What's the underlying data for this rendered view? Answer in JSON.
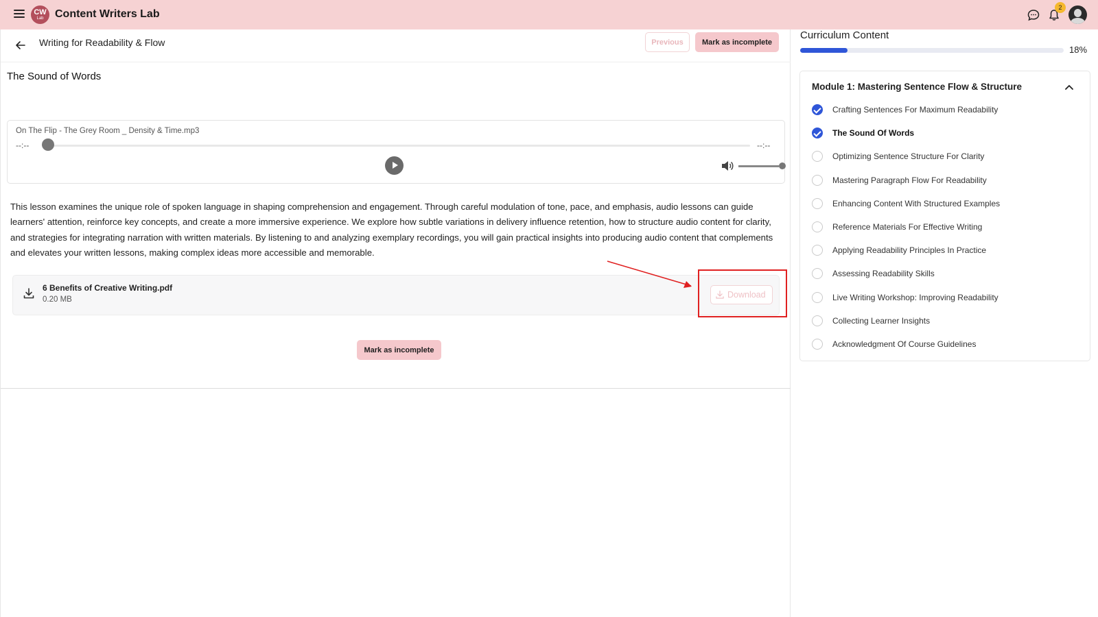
{
  "app": {
    "logo_text": "CW",
    "logo_sub": "Lab",
    "title": "Content Writers Lab",
    "notifications_count": "2"
  },
  "lesson": {
    "header_title": "Writing for Readability & Flow",
    "previous_label": "Previous",
    "mark_incomplete_label": "Mark as incomplete",
    "section_title": "The Sound of Words",
    "audio": {
      "file_name": "On The Flip - The Grey Room _ Density & Time.mp3",
      "current_time": "--:--",
      "duration": "--:--",
      "position_fraction": 0,
      "volume_fraction": 1.0
    },
    "description": "This lesson examines the unique role of spoken language in shaping comprehension and engagement. Through careful modulation of tone, pace, and emphasis, audio lessons can guide learners' attention, reinforce key concepts, and create a more immersive experience. We explore how subtle variations in delivery influence retention, how to structure audio content for clarity, and strategies for integrating narration with written materials. By listening to and analyzing exemplary recordings, you will gain practical insights into producing audio content that complements and elevates your written lessons, making complex ideas more accessible and memorable.",
    "attachment": {
      "file_name": "6 Benefits of Creative Writing.pdf",
      "file_size": "0.20 MB",
      "download_label": "Download"
    },
    "bottom_mark_label": "Mark as incomplete"
  },
  "curriculum": {
    "title": "Curriculum Content",
    "progress_percent": 18,
    "progress_text": "18%",
    "module": {
      "title": "Module 1: Mastering Sentence Flow & Structure",
      "lessons": [
        {
          "label": "Crafting Sentences For Maximum Readability",
          "done": true
        },
        {
          "label": "The Sound Of Words",
          "done": true,
          "active": true
        },
        {
          "label": "Optimizing Sentence Structure For Clarity",
          "done": false
        },
        {
          "label": "Mastering Paragraph Flow For Readability",
          "done": false
        },
        {
          "label": "Enhancing Content With Structured Examples",
          "done": false
        },
        {
          "label": "Reference Materials For Effective Writing",
          "done": false
        },
        {
          "label": "Applying Readability Principles In Practice",
          "done": false
        },
        {
          "label": "Assessing Readability Skills",
          "done": false
        },
        {
          "label": "Live Writing Workshop: Improving Readability",
          "done": false
        },
        {
          "label": "Collecting Learner Insights",
          "done": false
        },
        {
          "label": "Acknowledgment Of Course Guidelines",
          "done": false
        }
      ]
    }
  },
  "colors": {
    "topbar_bg": "#f6d2d3",
    "accent_blue": "#2f56d8",
    "button_pink": "#f5c8cc",
    "annotation_red": "#e02020"
  },
  "icons": [
    "menu-icon",
    "chat-icon",
    "bell-icon",
    "back-arrow-icon",
    "play-icon",
    "volume-icon",
    "download-icon",
    "chevron-up-icon",
    "check-icon"
  ]
}
